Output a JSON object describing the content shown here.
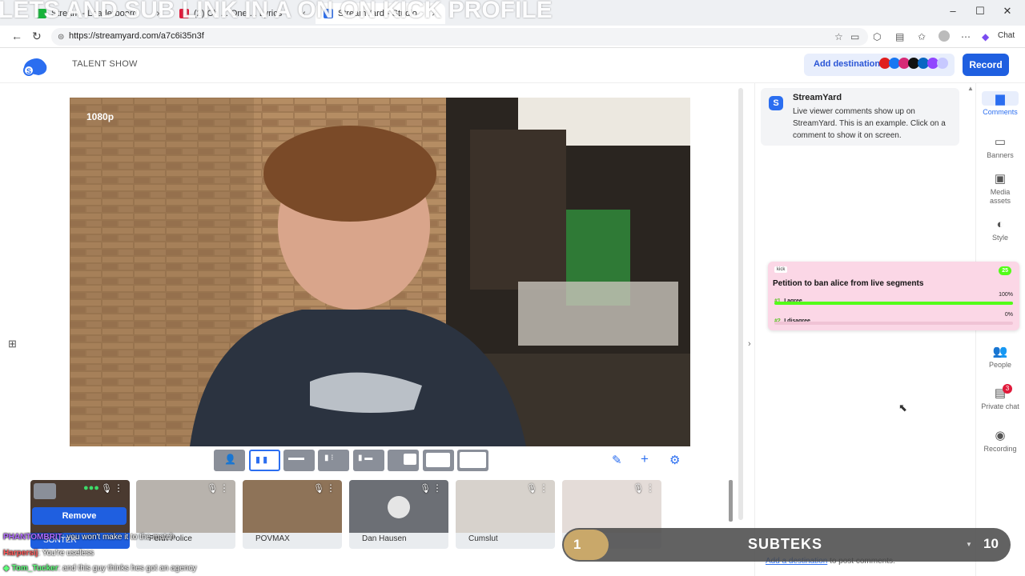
{
  "browser": {
    "overlay_title": "LETS AND SUB LINK IN A         ON ON KICK PROFILE",
    "tabs": [
      {
        "label": "Stream  - Leaderboard",
        "fav_color": "#16b33a"
      },
      {
        "label": "(2) Ch  ... One   ... Lyrics",
        "fav_color": "#e0193a"
      },
      {
        "label": "StreamYard - Studio",
        "fav_color": "#2b6ef0"
      }
    ],
    "url": "https://streamyard.com/a7c6i35n3f",
    "chat_button": "Chat",
    "window_controls": [
      "–",
      "☐",
      "✕"
    ]
  },
  "header": {
    "show_name": "TALENT SHOW",
    "add_destination": "Add destination",
    "record": "Record",
    "destination_colors": [
      "#e01e1e",
      "#1877f2",
      "#d62976",
      "#111111",
      "#0a66c2",
      "#9146ff",
      "#c7c9ff"
    ]
  },
  "stage": {
    "resolution": "1080p"
  },
  "participants": [
    {
      "name": "SONTER",
      "action": "Remove"
    },
    {
      "name": "Perth Police"
    },
    {
      "name": "POVMAX"
    },
    {
      "name": "Dan Hausen"
    },
    {
      "name": "Cumslut"
    },
    {
      "name": ""
    }
  ],
  "comments_panel": {
    "card_title": "StreamYard",
    "card_text": "Live viewer comments show up on StreamYard. This is an example. Click on a comment to show it on screen.",
    "footer_link": "Add a destination",
    "footer_text": " to post comments."
  },
  "side_nav": [
    {
      "label": "Comments",
      "icon": "comment-icon"
    },
    {
      "label": "Banners",
      "icon": "banner-icon"
    },
    {
      "label": "Media assets",
      "icon": "media-icon"
    },
    {
      "label": "Style",
      "icon": "palette-icon"
    },
    {
      "label": "People",
      "icon": "people-icon"
    },
    {
      "label": "Private chat",
      "icon": "chat-icon",
      "badge": "3"
    },
    {
      "label": "Recording",
      "icon": "record-icon"
    }
  ],
  "poll": {
    "platform": "kick",
    "count": "25",
    "title": "Petition to ban alice from live segments",
    "options": [
      {
        "rank": "#1",
        "label": "I agree",
        "percent": "100%",
        "fill": 1.0
      },
      {
        "rank": "#2",
        "label": "I disagree",
        "percent": "0%",
        "fill": 0.0
      }
    ],
    "accent": "#53fc18"
  },
  "chat_overlay": [
    {
      "user": "PHANTOMBRIT",
      "msg": ": you won't make it to the match",
      "color": "#b26bff"
    },
    {
      "user": "Harpersij",
      "msg": ": You're useless",
      "color": "#ff5a5a"
    },
    {
      "user": "Tom_Tucker",
      "msg": ": and this guy thinks hes got an agency",
      "color": "#5cff7a"
    }
  ],
  "subteks": {
    "left": "1",
    "label": "SUBTEKS",
    "right": "10",
    "progress": 0.1
  }
}
